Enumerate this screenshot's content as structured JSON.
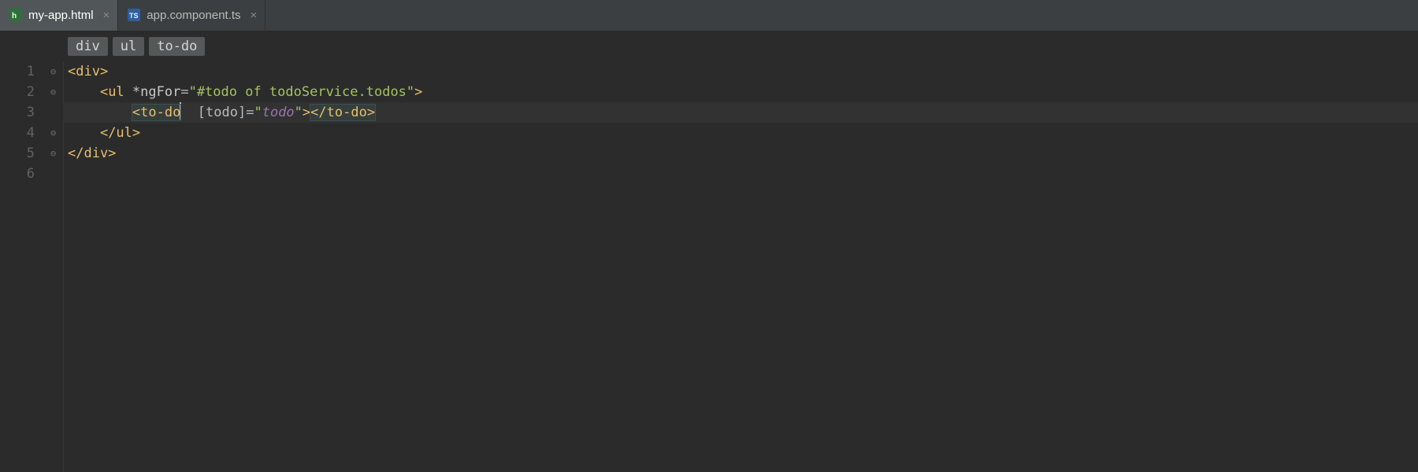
{
  "tabs": [
    {
      "label": "my-app.html",
      "active": true,
      "icon_kind": "html"
    },
    {
      "label": "app.component.ts",
      "active": false,
      "icon_kind": "ts"
    }
  ],
  "breadcrumbs": [
    "div",
    "ul",
    "to-do"
  ],
  "line_numbers": [
    "1",
    "2",
    "3",
    "4",
    "5",
    "6"
  ],
  "current_line_index": 2,
  "code_tokens": [
    [
      {
        "t": "<div>",
        "c": "tok-tag"
      }
    ],
    [
      {
        "t": "    ",
        "c": "tok-default"
      },
      {
        "t": "<ul ",
        "c": "tok-tag"
      },
      {
        "t": "*ngFor",
        "c": "tok-dir"
      },
      {
        "t": "=",
        "c": "tok-default"
      },
      {
        "t": "\"#todo of todoService.todos\"",
        "c": "tok-str"
      },
      {
        "t": ">",
        "c": "tok-tag"
      }
    ],
    [
      {
        "t": "        ",
        "c": "tok-default"
      },
      {
        "t": "<to-do",
        "c": "tok-tag",
        "matched": true
      },
      {
        "t": "  ",
        "c": "tok-default",
        "cursor_before": true
      },
      {
        "t": "[todo]",
        "c": "tok-attr"
      },
      {
        "t": "=",
        "c": "tok-default"
      },
      {
        "t": "\"",
        "c": "tok-str"
      },
      {
        "t": "todo",
        "c": "tok-var"
      },
      {
        "t": "\"",
        "c": "tok-str"
      },
      {
        "t": ">",
        "c": "tok-tag"
      },
      {
        "t": "</to-do>",
        "c": "tok-tag",
        "matched": true
      }
    ],
    [
      {
        "t": "    ",
        "c": "tok-default"
      },
      {
        "t": "</ul>",
        "c": "tok-tag"
      }
    ],
    [
      {
        "t": "</div>",
        "c": "tok-tag"
      }
    ],
    []
  ],
  "fold_marks": [
    {
      "line": 0,
      "glyph": "⊖"
    },
    {
      "line": 1,
      "glyph": "⊖"
    },
    {
      "line": 3,
      "glyph": "⊖"
    },
    {
      "line": 4,
      "glyph": "⊖"
    }
  ]
}
